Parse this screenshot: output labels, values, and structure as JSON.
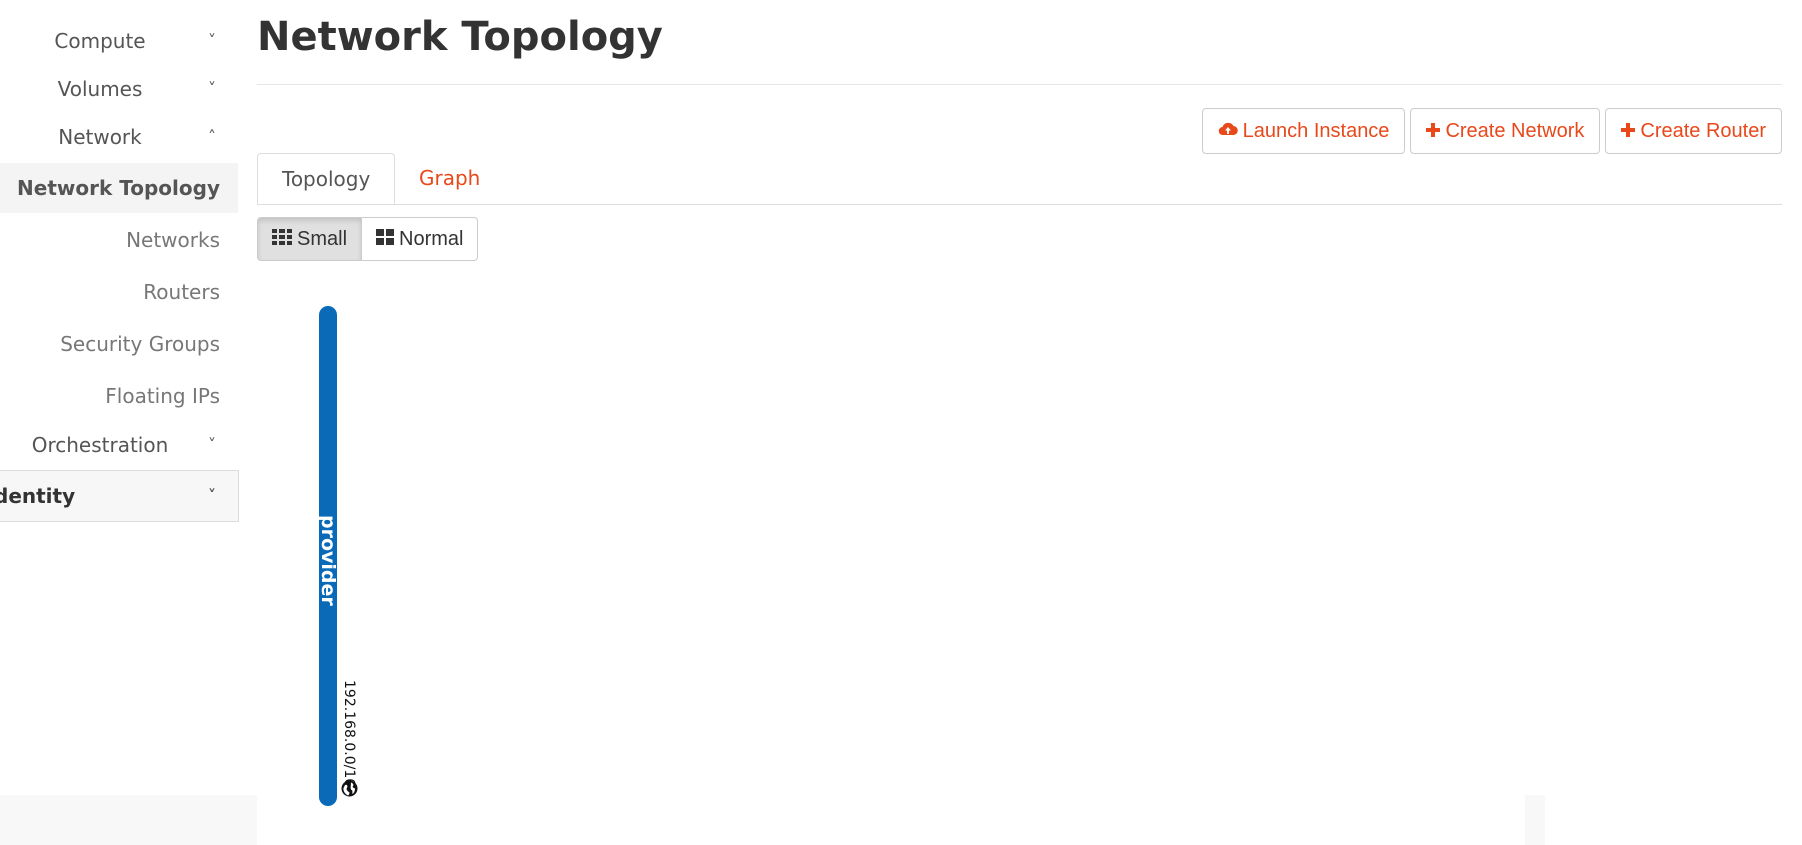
{
  "sidebar": {
    "compute": "Compute",
    "volumes": "Volumes",
    "network": "Network",
    "network_topology": "Network Topology",
    "networks": "Networks",
    "routers": "Routers",
    "security_groups": "Security Groups",
    "floating_ips": "Floating IPs",
    "orchestration": "Orchestration",
    "identity": "dentity",
    "chevron_down": "˅",
    "chevron_up": "˄"
  },
  "page": {
    "title": "Network Topology"
  },
  "actions": {
    "launch_instance": "Launch Instance",
    "create_network": "Create Network",
    "create_router": "Create Router"
  },
  "tabs": {
    "topology": "Topology",
    "graph": "Graph"
  },
  "view_toggle": {
    "small": "Small",
    "normal": "Normal",
    "selected": "Small"
  },
  "topology": {
    "network_name": "provider",
    "cidr": "192.168.0.0/16",
    "network_color": "#0a6ab8"
  },
  "colors": {
    "accent": "#e8481a"
  }
}
